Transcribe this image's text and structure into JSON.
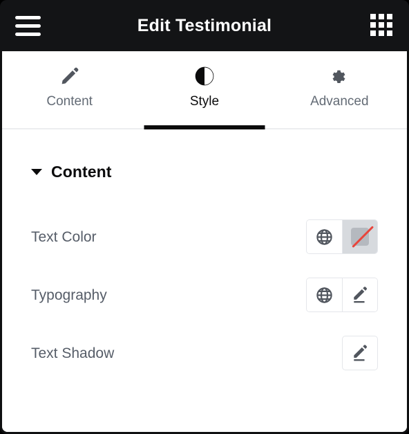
{
  "window": {
    "title": "Edit Testimonial",
    "menu_icon": "hamburger-menu-icon",
    "apps_icon": "grid-apps-icon",
    "bar_background": "#131416",
    "title_color": "#ffffff"
  },
  "tabs": [
    {
      "label": "Content",
      "icon": "pencil-icon",
      "active": false
    },
    {
      "label": "Style",
      "icon": "contrast-half-circle-icon",
      "active": true
    },
    {
      "label": "Advanced",
      "icon": "gear-icon",
      "active": false
    }
  ],
  "section": {
    "title": "Content",
    "expanded": true,
    "caret_icon": "caret-down-icon"
  },
  "controls": [
    {
      "label": "Text Color",
      "buttons": [
        {
          "icon": "globe-icon",
          "pressed": false
        },
        {
          "icon": "no-color-swatch-icon",
          "pressed": true
        }
      ]
    },
    {
      "label": "Typography",
      "buttons": [
        {
          "icon": "globe-icon",
          "pressed": false
        },
        {
          "icon": "pencil-edit-icon",
          "pressed": false
        }
      ]
    },
    {
      "label": "Text Shadow",
      "buttons": [
        {
          "icon": "pencil-edit-icon",
          "pressed": false
        }
      ]
    }
  ],
  "colors": {
    "accent_active": "#0b0b0c",
    "label_text": "#565d68",
    "icon_gray": "#51565e",
    "border": "#e4e6ea",
    "pressed_bg": "#d7dade",
    "swatch_gray": "#b5b9bf",
    "slash_red": "#e8453c"
  }
}
